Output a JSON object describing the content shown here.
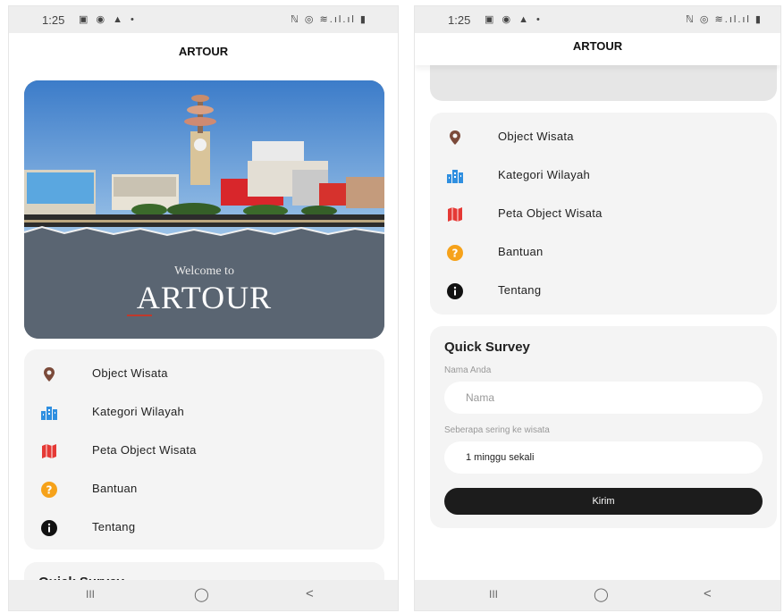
{
  "status": {
    "time": "1:25",
    "left_icons": "▣ ◉ ▲ •",
    "right_icons": "ℕ ◎ ≋.ıl.ıl ▮"
  },
  "app": {
    "title": "ARTOUR"
  },
  "hero": {
    "welcome": "Welcome to",
    "brand": "ARTOUR"
  },
  "menu": {
    "items": [
      {
        "label": "Object Wisata",
        "icon": "location-pin-icon",
        "color": "#7b4a3a"
      },
      {
        "label": "Kategori Wilayah",
        "icon": "city-buildings-icon",
        "color": "#2f8fe0"
      },
      {
        "label": "Peta Object Wisata",
        "icon": "map-icon",
        "color": "#e53935"
      },
      {
        "label": "Bantuan",
        "icon": "help-icon",
        "color": "#f6a21a"
      },
      {
        "label": "Tentang",
        "icon": "info-icon",
        "color": "#111111"
      }
    ]
  },
  "survey": {
    "title": "Quick Survey",
    "name_label": "Nama Anda",
    "name_placeholder": "Nama",
    "freq_label": "Seberapa sering ke wisata",
    "freq_value": "1 minggu sekali",
    "submit_label": "Kirim"
  },
  "nav": {
    "recents": "III",
    "home": "◯",
    "back": "<"
  }
}
